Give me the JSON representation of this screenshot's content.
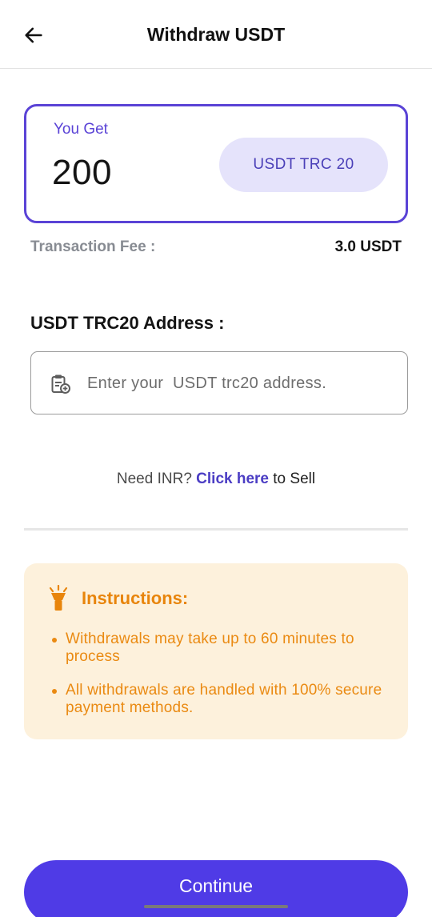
{
  "header": {
    "title": "Withdraw USDT",
    "back_icon": "arrow-left-icon"
  },
  "get_card": {
    "label": "You Get",
    "amount": "200",
    "currency": "USDT TRC 20",
    "accent_color": "#5a43d6"
  },
  "fee": {
    "label": "Transaction Fee  :",
    "value": "3.0 USDT"
  },
  "address": {
    "label": "USDT TRC20 Address  :",
    "placeholder": "Enter your  USDT trc20 address.",
    "value": "",
    "icon": "clipboard-paste-icon"
  },
  "need_inr": {
    "prefix": "Need INR?",
    "link": "Click here",
    "suffix": "to Sell"
  },
  "instructions": {
    "icon": "flashlight-icon",
    "title": "Instructions:",
    "items": [
      "Withdrawals may take up to 60 minutes to process",
      "All withdrawals are handled with 100% secure payment methods."
    ],
    "color": "#ea8a12"
  },
  "continue_label": "Continue",
  "primary_color": "#4f3be6"
}
